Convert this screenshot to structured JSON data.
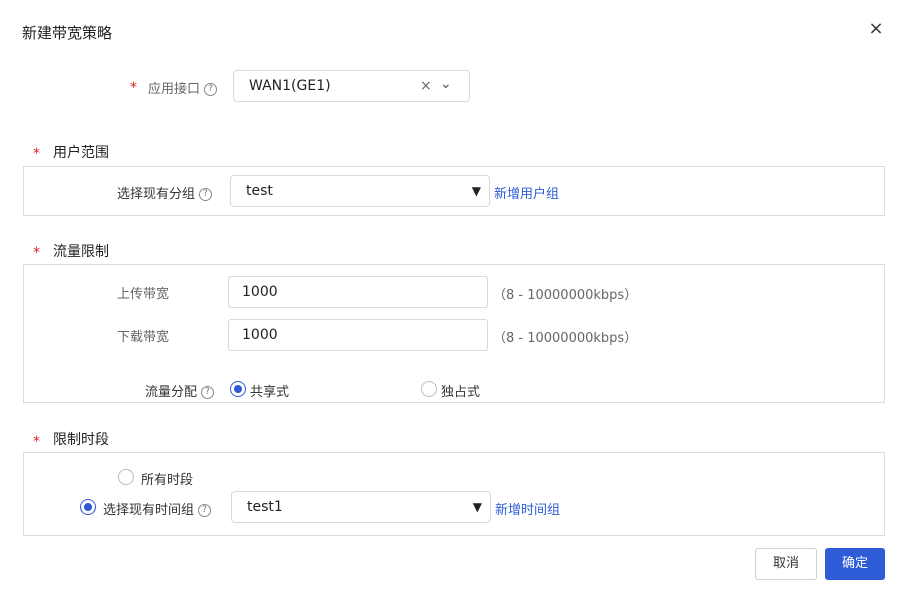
{
  "dialog": {
    "title": "新建带宽策略",
    "close_icon": "×"
  },
  "interface": {
    "required_mark": "*",
    "label": "应用接口",
    "help": "?",
    "value": "WAN1(GE1)",
    "clear_icon": "×",
    "chevron": "⌄"
  },
  "user_scope": {
    "required_mark": "*",
    "title": "用户范围",
    "group_label": "选择现有分组",
    "help": "?",
    "group_value": "test",
    "add_link": "新增用户组"
  },
  "traffic": {
    "required_mark": "*",
    "title": "流量限制",
    "upload_label": "上传带宽",
    "upload_value": "1000",
    "upload_hint": "（8 - 10000000kbps）",
    "download_label": "下载带宽",
    "download_value": "1000",
    "download_hint": "（8 - 10000000kbps）",
    "distribution_label": "流量分配",
    "help": "?",
    "option_shared": "共享式",
    "option_exclusive": "独占式",
    "selected": "共享式"
  },
  "time": {
    "required_mark": "*",
    "title": "限制时段",
    "option_all": "所有时段",
    "option_group": "选择现有时间组",
    "help": "?",
    "group_value": "test1",
    "add_link": "新增时间组",
    "selected": "选择现有时间组"
  },
  "footer": {
    "cancel_label": "取消",
    "ok_label": "确定"
  },
  "colors": {
    "accent": "#2d5cd6",
    "required": "#e02020",
    "border": "#dcdcdc"
  }
}
